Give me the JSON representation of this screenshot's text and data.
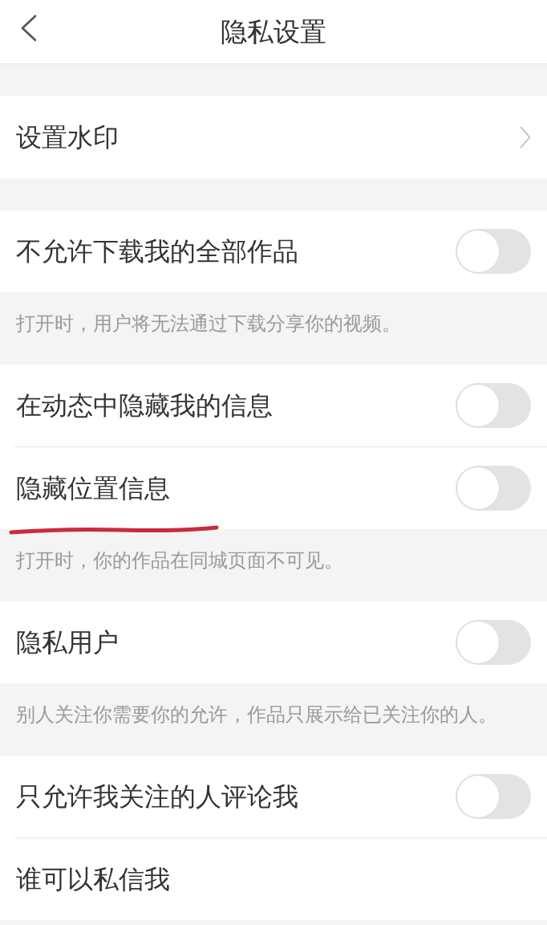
{
  "header": {
    "title": "隐私设置"
  },
  "sections": [
    {
      "items": [
        {
          "kind": "link",
          "label": "设置水印",
          "underlined": false
        }
      ]
    },
    {
      "items": [
        {
          "kind": "toggle",
          "label": "不允许下载我的全部作品",
          "on": false,
          "underlined": false
        }
      ],
      "note": "打开时，用户将无法通过下载分享你的视频。"
    },
    {
      "items": [
        {
          "kind": "toggle",
          "label": "在动态中隐藏我的信息",
          "on": false,
          "underlined": false
        },
        {
          "kind": "toggle",
          "label": "隐藏位置信息",
          "on": false,
          "underlined": true
        }
      ],
      "note": "打开时，你的作品在同城页面不可见。"
    },
    {
      "items": [
        {
          "kind": "toggle",
          "label": "隐私用户",
          "on": false,
          "underlined": false
        }
      ],
      "note": "别人关注你需要你的允许，作品只展示给已关注你的人。"
    },
    {
      "items": [
        {
          "kind": "toggle",
          "label": "只允许我关注的人评论我",
          "on": false,
          "underlined": false
        },
        {
          "kind": "plain",
          "label": "谁可以私信我",
          "underlined": false
        }
      ]
    }
  ]
}
